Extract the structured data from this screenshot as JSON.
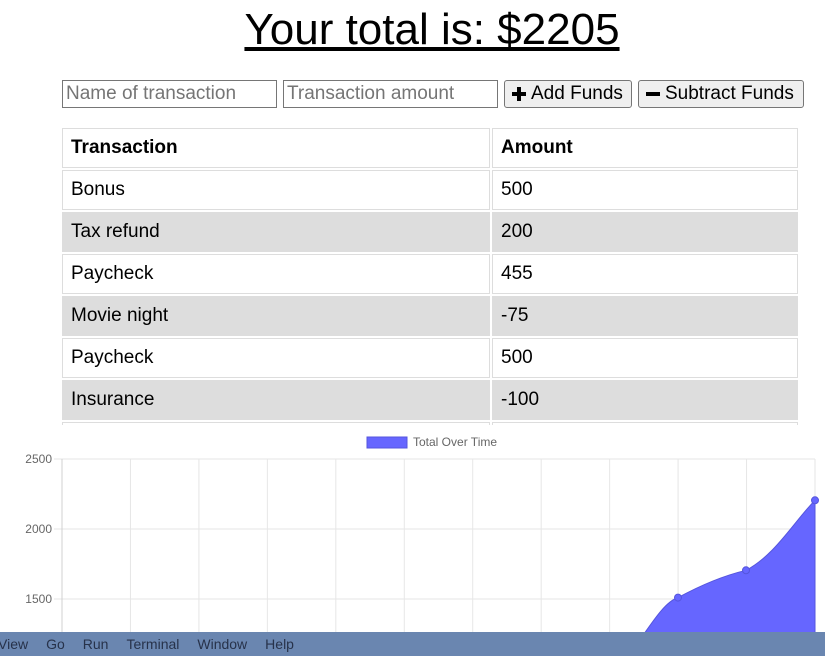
{
  "header": {
    "total_text": "Your total is: $2205"
  },
  "form": {
    "name_placeholder": "Name of transaction",
    "amount_placeholder": "Transaction amount",
    "add_label": "Add Funds",
    "subtract_label": "Subtract Funds",
    "add_icon": "plus-icon",
    "subtract_icon": "minus-icon"
  },
  "table": {
    "headers": [
      "Transaction",
      "Amount"
    ],
    "rows": [
      {
        "name": "Bonus",
        "amount": "500"
      },
      {
        "name": "Tax refund",
        "amount": "200"
      },
      {
        "name": "Paycheck",
        "amount": "455"
      },
      {
        "name": "Movie night",
        "amount": "-75"
      },
      {
        "name": "Paycheck",
        "amount": "500"
      },
      {
        "name": "Insurance",
        "amount": "-100"
      }
    ]
  },
  "chart_data": {
    "type": "area",
    "legend": {
      "label": "Total Over Time",
      "position": "top-center"
    },
    "series": [
      {
        "name": "Total Over Time",
        "color": "#6666ff",
        "values": [
          1510,
          1705,
          2205
        ]
      }
    ],
    "ylim": [
      1400,
      2500
    ],
    "yticks": [
      "2500",
      "2000",
      "1500"
    ],
    "grid": true
  },
  "menubar": {
    "items": [
      "View",
      "Go",
      "Run",
      "Terminal",
      "Window",
      "Help"
    ],
    "color": "#6a86b0"
  }
}
